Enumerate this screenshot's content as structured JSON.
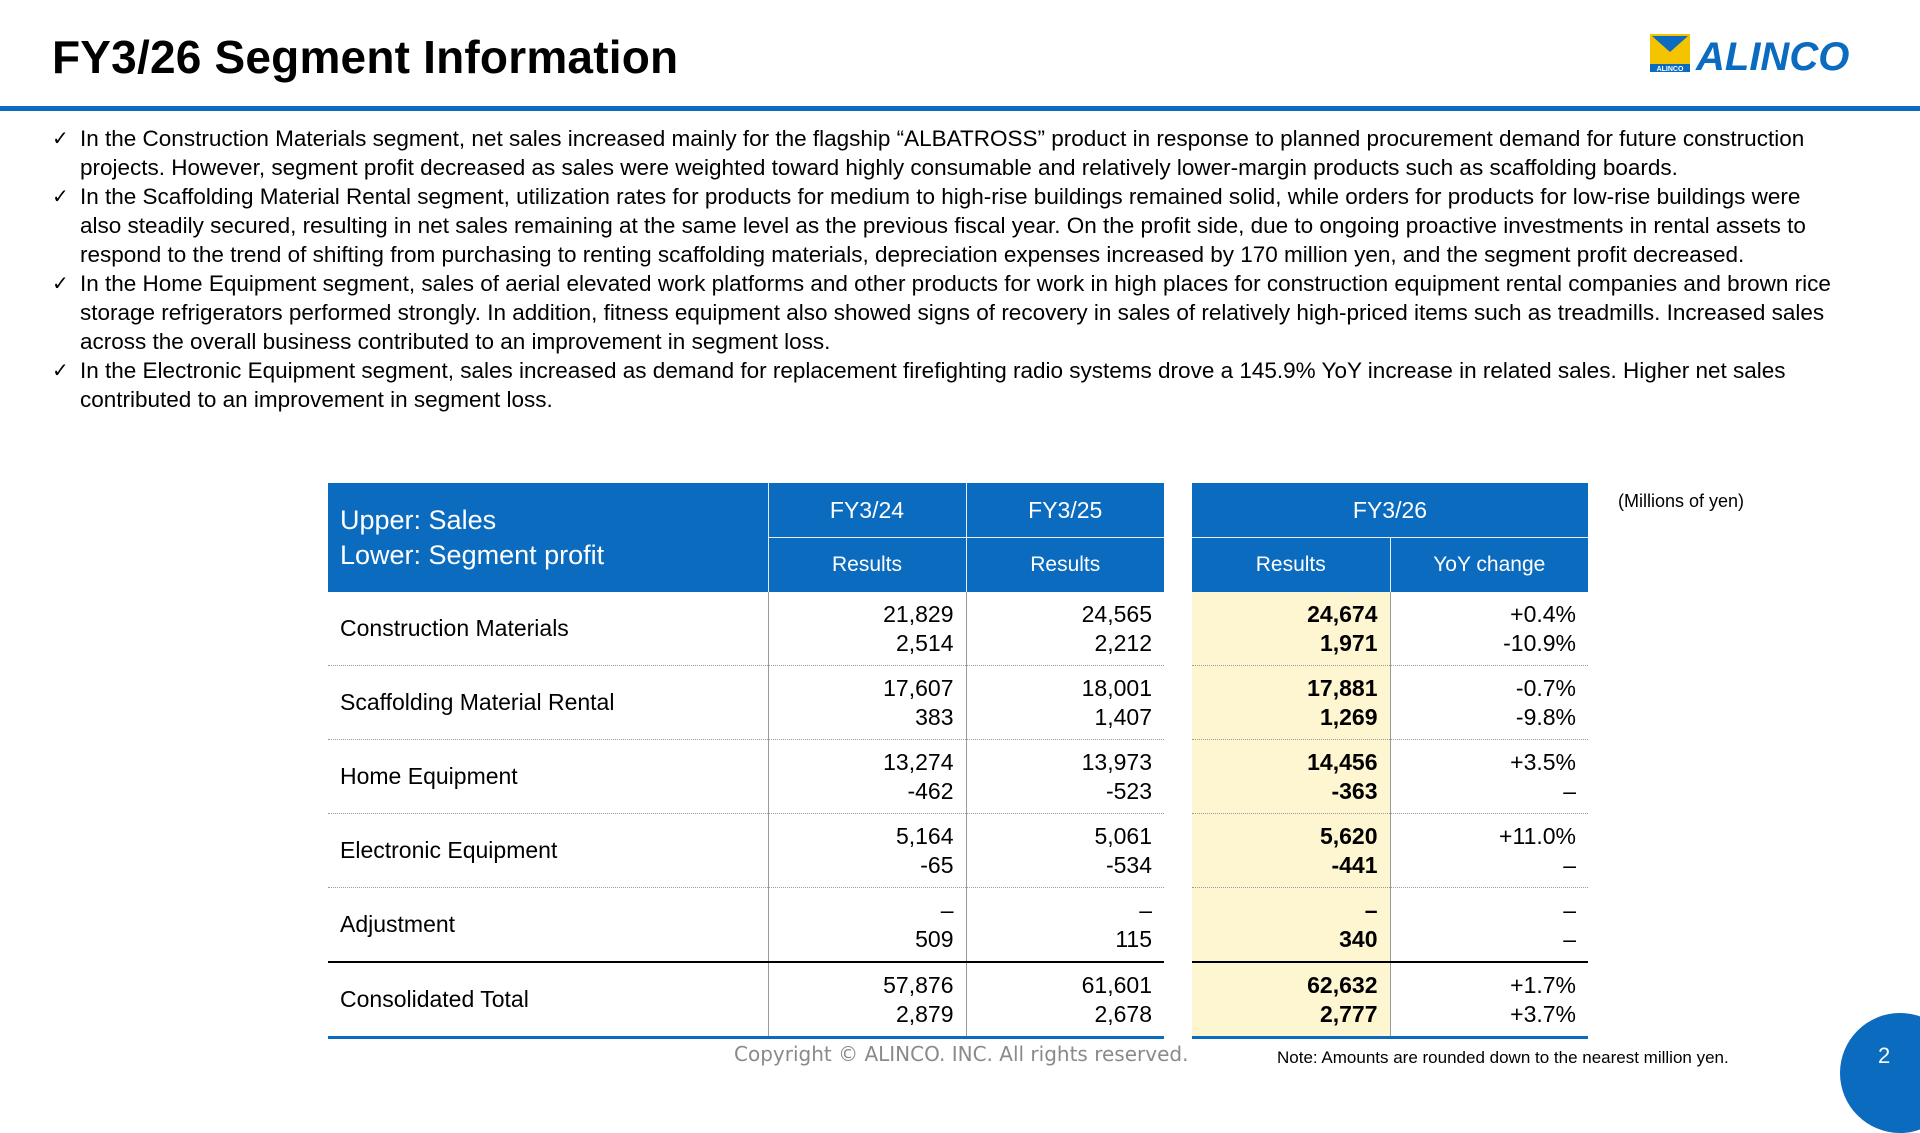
{
  "header": {
    "title": "FY3/26 Segment Information",
    "logo_text": "ALINCO",
    "logo_small": "ALINCO"
  },
  "bullets": [
    {
      "icon": "check-icon",
      "text": "In the Construction Materials segment, net sales increased mainly for the flagship “ALBATROSS” product in response to planned procurement demand for future construction projects. However, segment profit decreased as sales were weighted toward highly consumable and relatively lower-margin products such as scaffolding boards."
    },
    {
      "icon": "check-icon",
      "text": "In the Scaffolding Material Rental segment, utilization rates for products for medium to high-rise buildings remained solid, while orders for products for low-rise buildings were also steadily secured, resulting in net sales remaining at the same level as the previous fiscal year. On the profit side, due to ongoing proactive investments in rental assets to respond to the trend of shifting from purchasing to renting scaffolding materials, depreciation expenses increased by 170 million yen, and the segment profit decreased."
    },
    {
      "icon": "check-icon",
      "text": "In the Home Equipment segment, sales of aerial elevated work platforms and other products for work in high places for construction equipment rental companies and brown rice storage refrigerators performed strongly. In addition, fitness equipment also showed signs of recovery in sales of relatively high-priced items such as treadmills. Increased sales across the overall business contributed to an improvement in segment loss."
    },
    {
      "icon": "check-icon",
      "text": "In the Electronic Equipment segment, sales increased as demand for replacement firefighting radio systems drove a 145.9% YoY increase in related sales. Higher net sales contributed to an improvement in segment loss."
    }
  ],
  "units": "(Millions of yen)",
  "table": {
    "corner_line1": "Upper: Sales",
    "corner_line2": "Lower: Segment profit",
    "fy24": "FY3/24",
    "fy25": "FY3/25",
    "fy26": "FY3/26",
    "results": "Results",
    "yoy": "YoY change",
    "rows": [
      {
        "name": "Construction Materials",
        "fy24": [
          "21,829",
          "2,514"
        ],
        "fy25": [
          "24,565",
          "2,212"
        ],
        "fy26": [
          "24,674",
          "1,971"
        ],
        "yoy": [
          "+0.4%",
          "-10.9%"
        ]
      },
      {
        "name": "Scaffolding Material Rental",
        "fy24": [
          "17,607",
          "383"
        ],
        "fy25": [
          "18,001",
          "1,407"
        ],
        "fy26": [
          "17,881",
          "1,269"
        ],
        "yoy": [
          "-0.7%",
          "-9.8%"
        ]
      },
      {
        "name": "Home Equipment",
        "fy24": [
          "13,274",
          "-462"
        ],
        "fy25": [
          "13,973",
          "-523"
        ],
        "fy26": [
          "14,456",
          "-363"
        ],
        "yoy": [
          "+3.5%",
          "–"
        ]
      },
      {
        "name": "Electronic Equipment",
        "fy24": [
          "5,164",
          "-65"
        ],
        "fy25": [
          "5,061",
          "-534"
        ],
        "fy26": [
          "5,620",
          "-441"
        ],
        "yoy": [
          "+11.0%",
          "–"
        ]
      },
      {
        "name": "Adjustment",
        "fy24": [
          "–",
          "509"
        ],
        "fy25": [
          "–",
          "115"
        ],
        "fy26": [
          "–",
          "340"
        ],
        "yoy": [
          "–",
          "–"
        ]
      },
      {
        "name": "Consolidated Total",
        "fy24": [
          "57,876",
          "2,879"
        ],
        "fy25": [
          "61,601",
          "2,678"
        ],
        "fy26": [
          "62,632",
          "2,777"
        ],
        "yoy": [
          "+1.7%",
          "+3.7%"
        ]
      }
    ]
  },
  "footer": {
    "copyright": "Copyright © ALINCO. INC. All rights reserved.",
    "note": "Note: Amounts are rounded down to the nearest million yen.",
    "page": "2"
  },
  "colors": {
    "accent": "#0a6bbf",
    "highlight": "#fdf6d0",
    "logo_yellow": "#f5c400"
  }
}
